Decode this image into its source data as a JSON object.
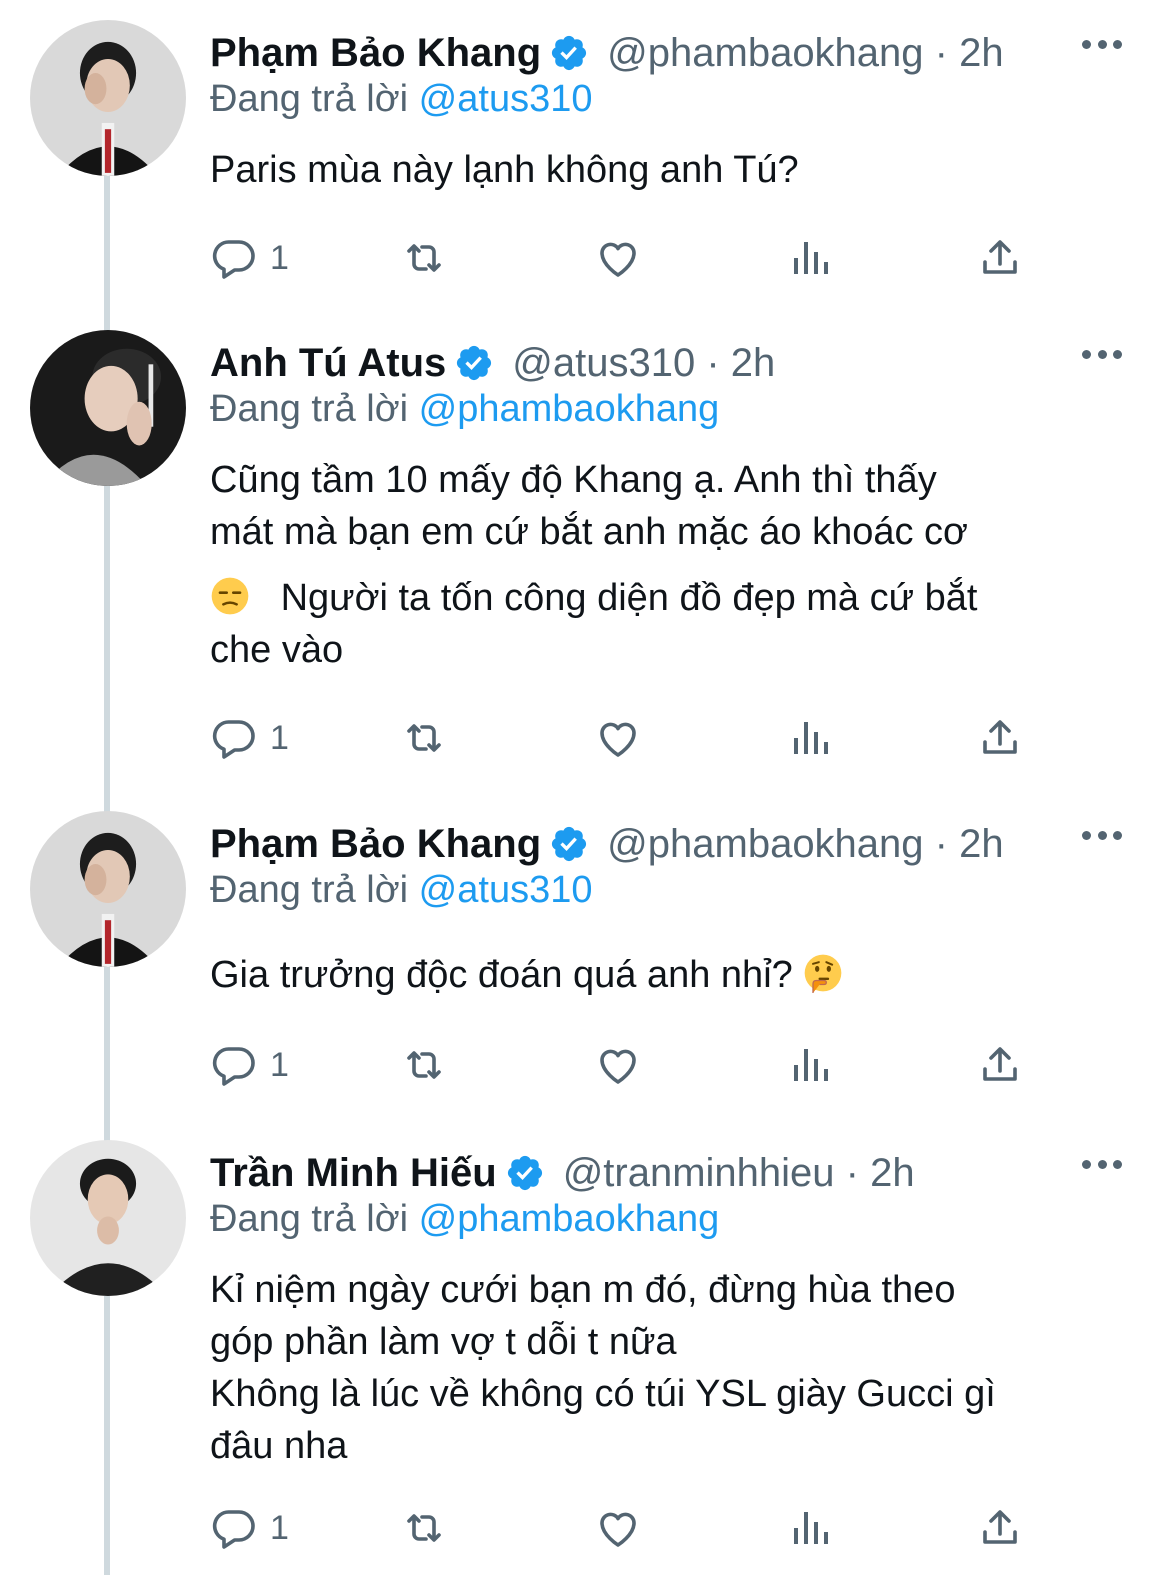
{
  "tweets": [
    {
      "name": "Phạm Bảo Khang",
      "handle": "@phambaokhang · 2h",
      "reply_prefix": "Đang trả lời",
      "reply_to": "@atus310",
      "body": [
        "Paris mùa này lạnh không anh Tú?"
      ],
      "reply_count": "1"
    },
    {
      "name": "Anh Tú Atus",
      "handle": "@atus310 · 2h",
      "reply_prefix": "Đang trả lời",
      "reply_to": "@phambaokhang",
      "body": [
        "Cũng tầm 10 mấy độ Khang ạ. Anh thì thấy",
        "mát mà bạn em cứ bắt anh mặc áo khoác cơ",
        "Người ta tốn công diện đồ đẹp mà cứ bắt",
        "che vào"
      ],
      "reply_count": "1"
    },
    {
      "name": "Phạm Bảo Khang",
      "handle": "@phambaokhang · 2h",
      "reply_prefix": "Đang trả lời",
      "reply_to": "@atus310",
      "body": [
        "Gia trưởng độc đoán quá anh nhỉ?"
      ],
      "reply_count": "1"
    },
    {
      "name": "Trần Minh Hiếu",
      "handle": "@tranminhhieu · 2h",
      "reply_prefix": "Đang trả lời",
      "reply_to": "@phambaokhang",
      "body": [
        "Kỉ niệm ngày cưới bạn m đó, đừng hùa theo",
        "góp phần làm vợ t dỗi t nữa",
        "Không là lúc về không có túi YSL giày Gucci gì",
        "đâu nha"
      ],
      "reply_count": "1"
    }
  ],
  "icons": {
    "verified": "verified-badge-icon",
    "more": "more-icon",
    "reply": "reply-icon",
    "retweet": "retweet-icon",
    "like": "like-icon",
    "views": "views-icon",
    "share": "share-icon",
    "unamused_emoji": "unamused-face-emoji",
    "thinking_emoji": "thinking-face-emoji"
  },
  "colors": {
    "accent": "#1d9bf0",
    "text": "#0f1419",
    "secondary": "#536471",
    "thread_line": "#cfd9de"
  }
}
